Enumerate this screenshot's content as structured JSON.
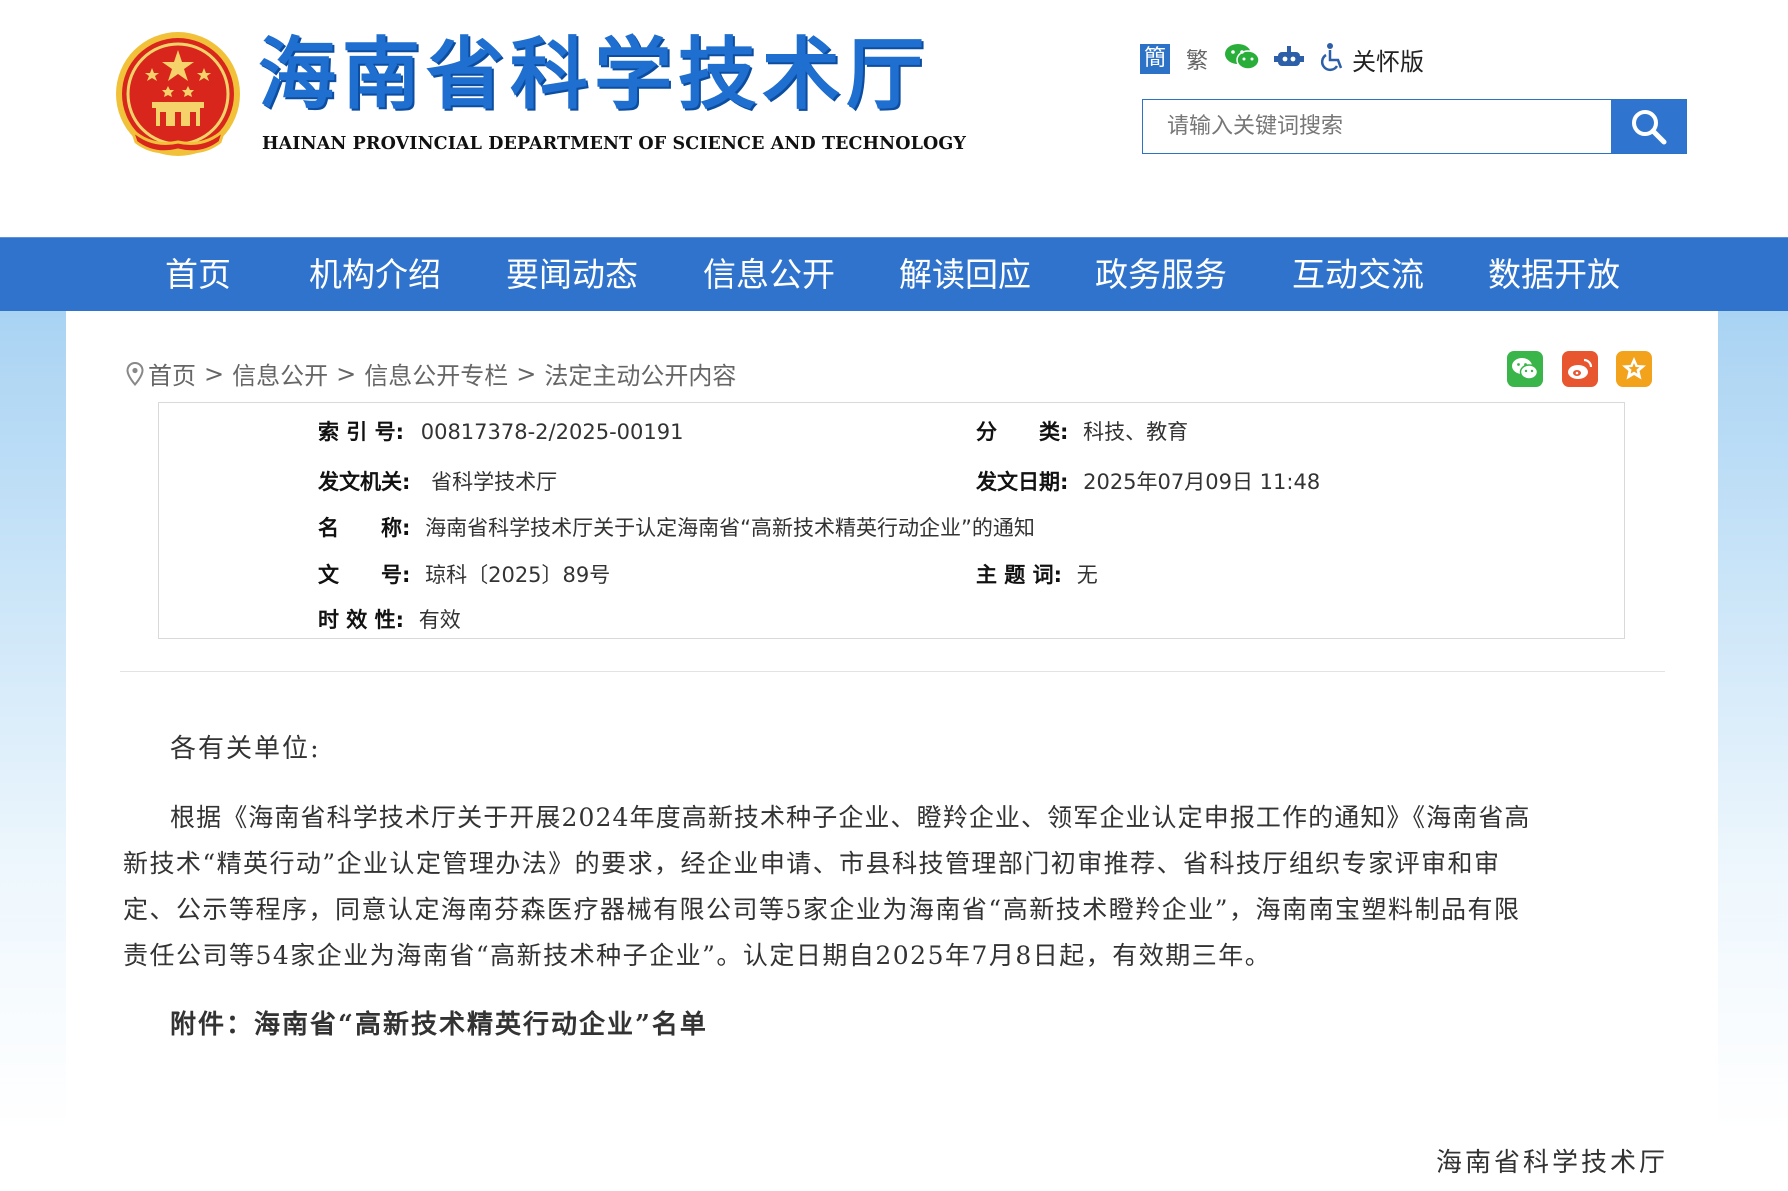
{
  "header": {
    "title": "海南省科学技术厅",
    "subtitle": "HAINAN PROVINCIAL DEPARTMENT OF SCIENCE AND TECHNOLOGY",
    "tools": {
      "simplified": "簡",
      "traditional": "繁",
      "care": "关怀版"
    },
    "search_placeholder": "请输入关键词搜索"
  },
  "nav": [
    "首页",
    "机构介绍",
    "要闻动态",
    "信息公开",
    "解读回应",
    "政务服务",
    "互动交流",
    "数据开放"
  ],
  "breadcrumb": [
    "首页",
    "信息公开",
    "信息公开专栏",
    "法定主动公开内容"
  ],
  "meta": {
    "index_label": "索 引 号:",
    "index_value": "00817378-2/2025-00191",
    "category_label": "分　　类:",
    "category_value": "科技、教育",
    "issuer_label": "发文机关:",
    "issuer_value": "省科学技术厅",
    "date_label": "发文日期:",
    "date_value": "2025年07月09日 11:48",
    "name_label": "名　　称:",
    "name_value": "海南省科学技术厅关于认定海南省“高新技术精英行动企业”的通知",
    "docno_label": "文　　号:",
    "docno_value": "琼科〔2025〕89号",
    "keywords_label": "主 题 词:",
    "keywords_value": "无",
    "validity_label": "时 效 性:",
    "validity_value": "有效"
  },
  "article": {
    "salutation": "各有关单位:",
    "body_lines": [
      "根据《海南省科学技术厅关于开展2024年度高新技术种子企业、瞪羚企业、领军企业认定申报工作的通知》《海南省高",
      "新技术“精英行动”企业认定管理办法》的要求，经企业申请、市县科技管理部门初审推荐、省科技厅组织专家评审和审",
      "定、公示等程序，同意认定海南芬森医疗器械有限公司等5家企业为海南省“高新技术瞪羚企业”，海南南宝塑料制品有限",
      "责任公司等54家企业为海南省“高新技术种子企业”。认定日期自2025年7月8日起，有效期三年。"
    ],
    "attachment": "附件：海南省“高新技术精英行动企业”名单",
    "signature": "海南省科学技术厅"
  },
  "colors": {
    "brand_blue": "#2f73cd",
    "emblem_red": "#d8261c",
    "emblem_gold": "#f2c13a"
  },
  "icons": [
    "national-emblem",
    "wechat-icon",
    "robot-icon",
    "accessibility-icon",
    "search-icon",
    "location-pin-icon",
    "weibo-icon",
    "favorite-star-icon"
  ]
}
